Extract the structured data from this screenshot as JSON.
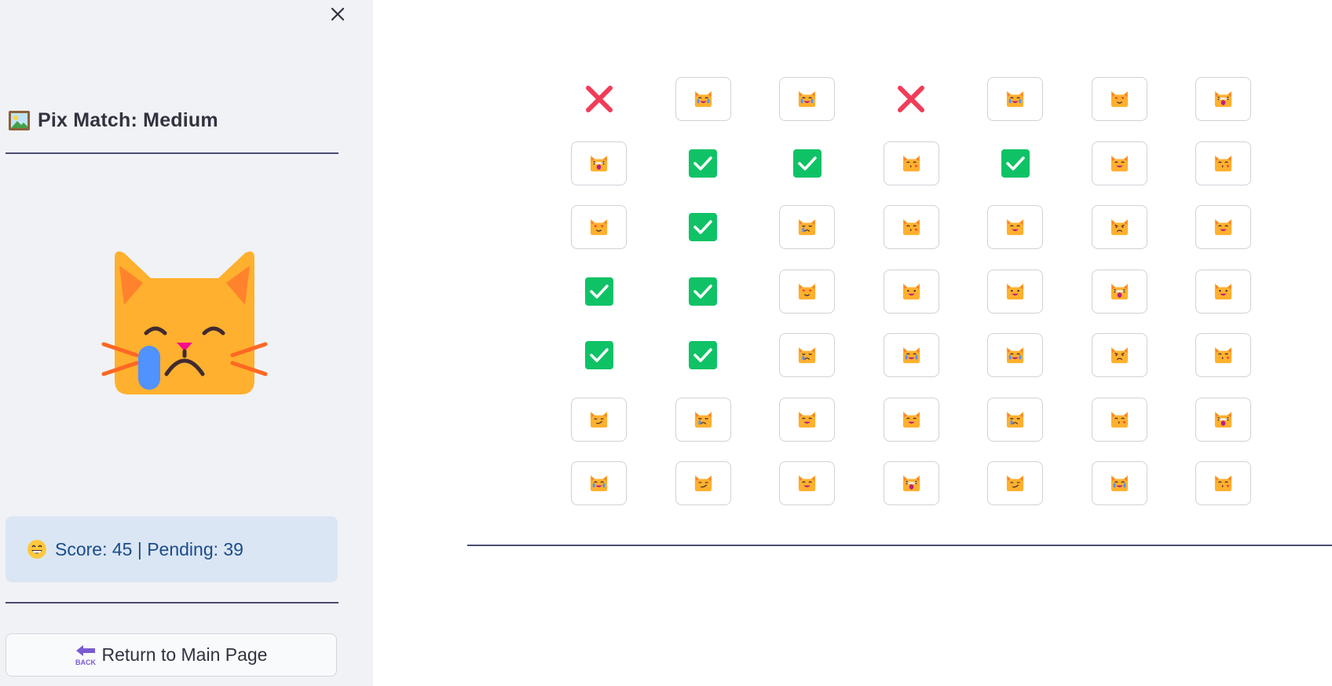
{
  "sidebar": {
    "title_icon": "framed-picture-icon",
    "title": "Pix Match: Medium",
    "close_icon": "close-icon",
    "current_image_icon": "crying-cat-icon",
    "score_emoji": "grinning-face-icon",
    "score_text": "Score: 45 | Pending: 39",
    "back_icon": "back-arrow-icon",
    "back_label": "Return to Main Page"
  },
  "colors": {
    "sidebar_bg": "#f0f2f6",
    "score_bg": "#dbe6f4",
    "score_text": "#1a4b8c",
    "check_green": "#10c266",
    "cross_red": "#f13c59",
    "cat_orange": "#ffb02e",
    "divider": "#4b4d72"
  },
  "board": {
    "rows": 7,
    "cols": 7,
    "cells": [
      [
        "wrong",
        "cat-joy",
        "cat-joy",
        "wrong",
        "cat-joy",
        "cat-heart-eyes",
        "cat-weary"
      ],
      [
        "cat-weary",
        "correct",
        "correct",
        "cat-kissing",
        "correct",
        "cat-smile",
        "cat-kissing"
      ],
      [
        "cat-heart-eyes",
        "correct",
        "cat-crying",
        "cat-kissing",
        "cat-smile",
        "cat-pouting",
        "cat-smile"
      ],
      [
        "correct",
        "correct",
        "cat-heart-eyes",
        "cat-grin",
        "cat-grin",
        "cat-weary",
        "cat-grin"
      ],
      [
        "correct",
        "correct",
        "cat-crying",
        "cat-joy",
        "cat-joy",
        "cat-pouting",
        "cat-kissing"
      ],
      [
        "cat-smirk",
        "cat-crying",
        "cat-smile",
        "cat-smile",
        "cat-crying",
        "cat-kissing",
        "cat-weary"
      ],
      [
        "cat-joy",
        "cat-smirk",
        "cat-smile",
        "cat-weary",
        "cat-smirk",
        "cat-joy",
        "cat-kissing"
      ]
    ]
  }
}
